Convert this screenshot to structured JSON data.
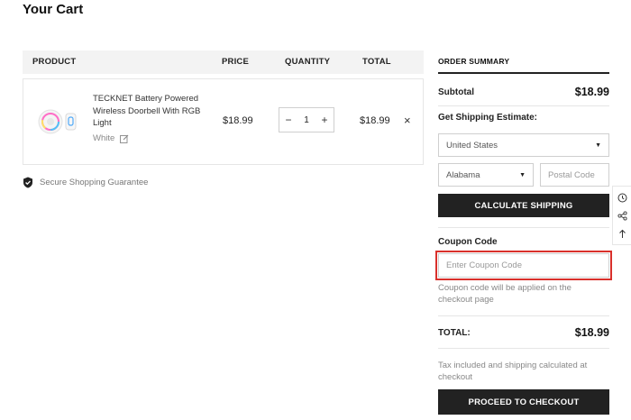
{
  "page": {
    "title": "Your Cart"
  },
  "table": {
    "headers": {
      "product": "PRODUCT",
      "price": "PRICE",
      "quantity": "QUANTITY",
      "total": "TOTAL"
    },
    "items": [
      {
        "name": "TECKNET Battery Powered Wireless Doorbell With RGB Light",
        "variant": "White",
        "price": "$18.99",
        "quantity": "1",
        "total": "$18.99",
        "minus": "−",
        "plus": "+",
        "remove": "×"
      }
    ]
  },
  "secure": {
    "text": "Secure Shopping Guarantee"
  },
  "summary": {
    "title": "ORDER SUMMARY",
    "subtotal_label": "Subtotal",
    "subtotal_value": "$18.99",
    "shipping_label": "Get Shipping Estimate:",
    "country": "United States",
    "state": "Alabama",
    "postal_placeholder": "Postal Code",
    "calculate_label": "CALCULATE SHIPPING",
    "coupon_label": "Coupon Code",
    "coupon_placeholder": "Enter Coupon Code",
    "coupon_note": "Coupon code will be applied on the checkout page",
    "total_label": "TOTAL:",
    "total_value": "$18.99",
    "tax_note": "Tax included and shipping calculated at checkout",
    "checkout_label": "PROCEED TO CHECKOUT"
  },
  "side_tools": [
    "history-icon",
    "share-icon",
    "scroll-top-icon"
  ],
  "colors": {
    "button_bg": "#222222",
    "highlight": "#d9302b",
    "header_bg": "#f3f3f3"
  }
}
